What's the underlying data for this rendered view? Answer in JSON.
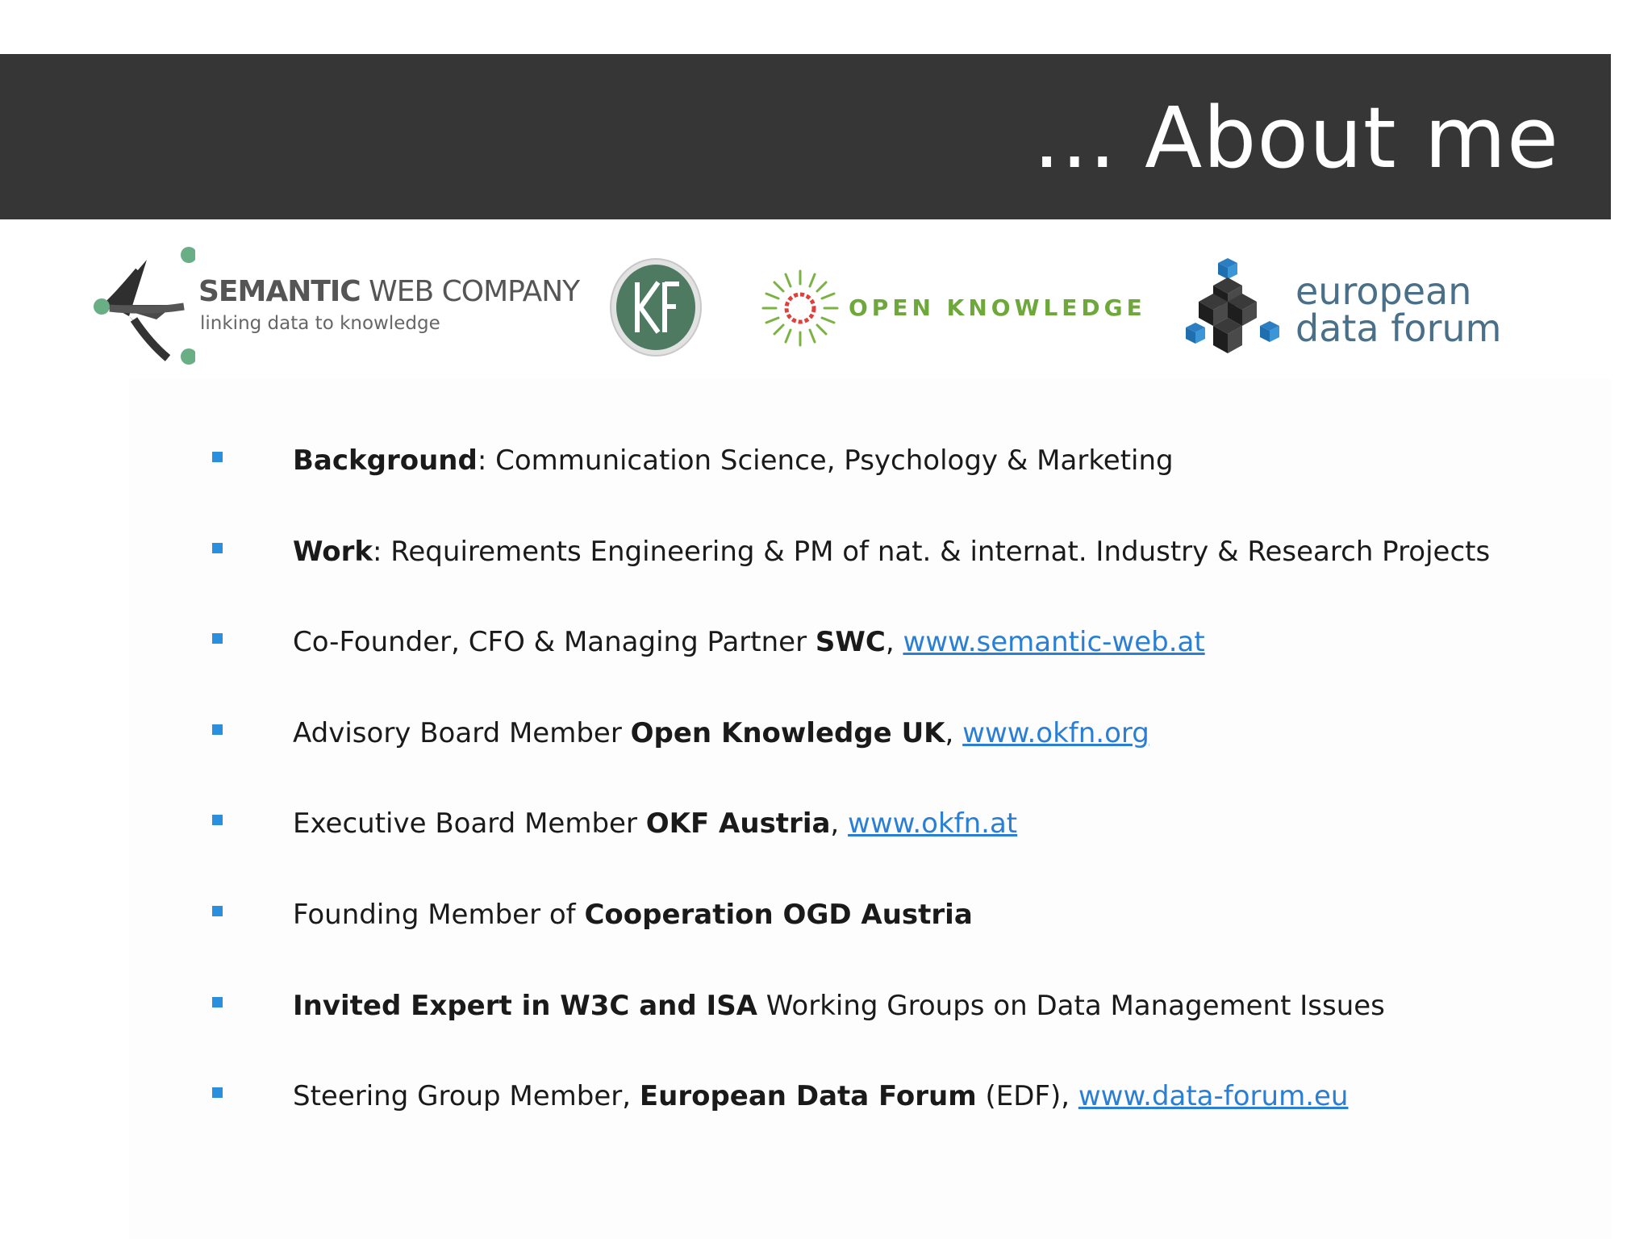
{
  "slide": {
    "title": "… About me"
  },
  "logos": {
    "swc": {
      "name_bold": "SEMANTIC",
      "name_rest": " WEB COMPANY",
      "tagline": "linking data to knowledge"
    },
    "okf": {
      "monogram": "KF"
    },
    "ok": {
      "name": "OPEN KNOWLEDGE"
    },
    "edf": {
      "line1": "european",
      "line2": "data forum"
    }
  },
  "bullets": [
    {
      "bold": "Background",
      "text": ": Communication Science, Psychology & Marketing"
    },
    {
      "bold": "Work",
      "text": ": Requirements Engineering & PM of nat. & internat. Industry & Research Projects"
    },
    {
      "text": "Co-Founder, CFO & Managing Partner ",
      "bold": "SWC",
      "text2": ", ",
      "link": "www.semantic-web.at"
    },
    {
      "text": "Advisory Board Member ",
      "bold": "Open Knowledge UK",
      "text2": ", ",
      "link": "www.okfn.org"
    },
    {
      "text": "Executive Board Member ",
      "bold": "OKF Austria",
      "text2": ", ",
      "link": "www.okfn.at"
    },
    {
      "text": "Founding Member of ",
      "bold": "Cooperation OGD Austria"
    },
    {
      "bold": "Invited Expert in W3C and ISA",
      "text": " Working Groups on Data Management Issues"
    },
    {
      "text": "Steering Group Member, ",
      "bold": "European Data Forum",
      "text2": " (EDF), ",
      "link": "www.data-forum.eu"
    }
  ],
  "colors": {
    "title_bar": "#363636",
    "bullet_marker": "#2a8fdc",
    "link": "#2a7fd4",
    "open_knowledge_green": "#6ea83a",
    "edf_text": "#4a6f88"
  }
}
